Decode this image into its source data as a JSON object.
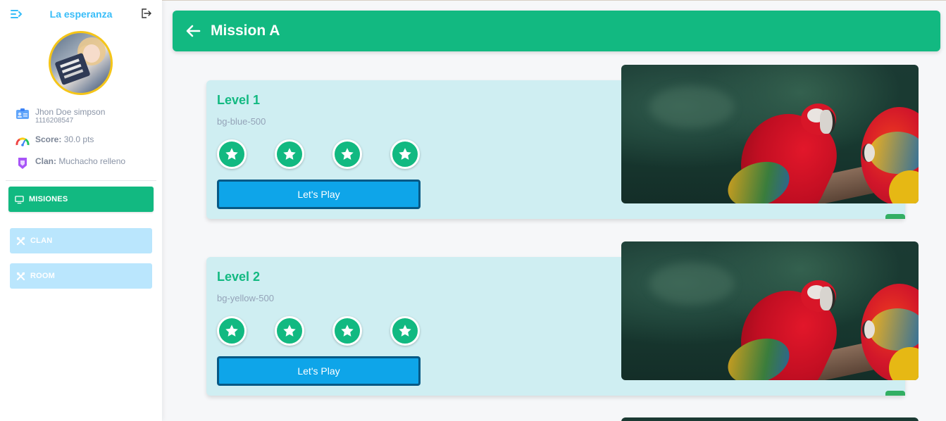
{
  "sidebar": {
    "app_title": "La esperanza",
    "user": {
      "name": "Jhon Doe simpson",
      "id": "1116208547"
    },
    "score": {
      "label": "Score:",
      "value": "30.0 pts"
    },
    "clan": {
      "label": "Clan:",
      "value": "Muchacho relleno"
    },
    "nav": {
      "misiones": "MISIONES",
      "clan": "CLAN",
      "room": "ROOM"
    }
  },
  "header": {
    "title": "Mission A"
  },
  "levels": [
    {
      "title": "Level 1",
      "subtitle": "bg-blue-500",
      "button": "Let's Play",
      "stars": 4
    },
    {
      "title": "Level 2",
      "subtitle": "bg-yellow-500",
      "button": "Let's Play",
      "stars": 4
    }
  ],
  "colors": {
    "primary_green": "#12b981",
    "play_blue": "#0ea5e9",
    "card_bg": "#cfeef2",
    "title_blue": "#38bdf8",
    "disabled_nav": "#bae6fd"
  },
  "icons": {
    "menu": "menu-toggle-icon",
    "logout": "logout-icon",
    "user": "id-card-icon",
    "score": "gauge-icon",
    "clan": "clan-badge-icon",
    "misiones": "monitor-icon",
    "clan_nav": "tools-icon",
    "room_nav": "tools-icon",
    "back": "arrow-left-icon",
    "star": "star-icon"
  }
}
